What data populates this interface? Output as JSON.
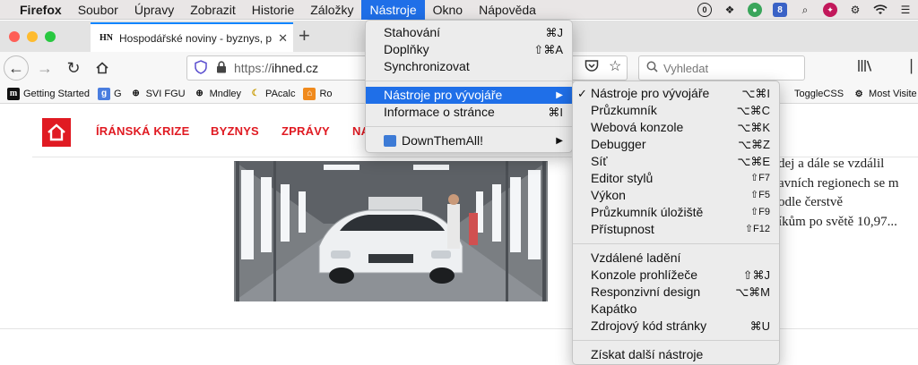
{
  "menubar": {
    "items": [
      "Firefox",
      "Soubor",
      "Úpravy",
      "Zobrazit",
      "Historie",
      "Záložky",
      "Nástroje",
      "Okno",
      "Nápověda"
    ]
  },
  "tab": {
    "favicon_text": "HN",
    "title": "Hospodářské noviny - byznys, p"
  },
  "toolbar": {
    "url_scheme": "https://",
    "url_host": "ihned.cz",
    "search_placeholder": "Vyhledat"
  },
  "bookmarks": {
    "items": [
      "Getting Started",
      "G",
      "SVI FGU",
      "Mndley",
      "PAcalc",
      "Ro"
    ],
    "right_items": [
      "ToggleCSS",
      "Most Visite"
    ]
  },
  "site": {
    "nav_links": [
      "ÍRÁNSKÁ KRIZE",
      "BYZNYS",
      "ZPRÁVY",
      "NA"
    ],
    "article_lines": [
      "dej a dále se vzdálil",
      "avních regionech se m",
      "odle čerstvě",
      "íkům po světě 10,97..."
    ]
  },
  "tools_menu": {
    "items": [
      {
        "label": "Stahování",
        "shortcut": "⌘J"
      },
      {
        "label": "Doplňky",
        "shortcut": "⇧⌘A"
      },
      {
        "label": "Synchronizovat",
        "shortcut": ""
      },
      {
        "label": "Nástroje pro vývojáře",
        "shortcut": ""
      },
      {
        "label": "Informace o stránce",
        "shortcut": "⌘I"
      },
      {
        "label": "DownThemAll!",
        "shortcut": ""
      }
    ]
  },
  "dev_menu": {
    "items": [
      {
        "label": "Nástroje pro vývojáře",
        "shortcut": "⌥⌘I"
      },
      {
        "label": "Průzkumník",
        "shortcut": "⌥⌘C"
      },
      {
        "label": "Webová konzole",
        "shortcut": "⌥⌘K"
      },
      {
        "label": "Debugger",
        "shortcut": "⌥⌘Z"
      },
      {
        "label": "Síť",
        "shortcut": "⌥⌘E"
      },
      {
        "label": "Editor stylů",
        "shortcut": "⇧F7"
      },
      {
        "label": "Výkon",
        "shortcut": "⇧F5"
      },
      {
        "label": "Průzkumník úložiště",
        "shortcut": "⇧F9"
      },
      {
        "label": "Přístupnost",
        "shortcut": "⇧F12"
      },
      {
        "label": "Vzdálené ladění",
        "shortcut": ""
      },
      {
        "label": "Konzole prohlížeče",
        "shortcut": "⇧⌘J"
      },
      {
        "label": "Responzivní design",
        "shortcut": "⌥⌘M"
      },
      {
        "label": "Kapátko",
        "shortcut": ""
      },
      {
        "label": "Zdrojový kód stránky",
        "shortcut": "⌘U"
      },
      {
        "label": "Získat další nástroje",
        "shortcut": ""
      }
    ]
  },
  "colors": {
    "accent": "#1f6fe8",
    "brand_red": "#e01a22",
    "tab_blue": "#0a84ff"
  }
}
